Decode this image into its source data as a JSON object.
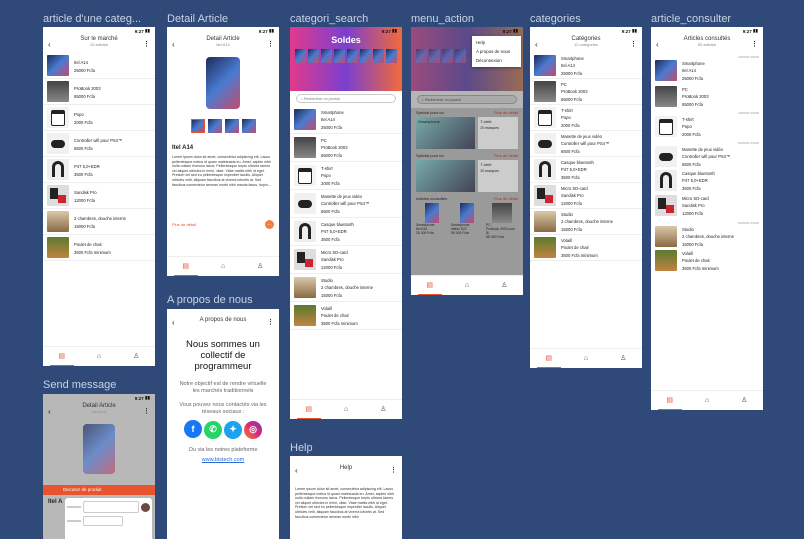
{
  "labels": {
    "article_categ": "article d'une categ...",
    "detail_article": "Detail Article",
    "categori_search": "categori_search",
    "menu_action": "menu_action",
    "categories": "categories",
    "article_consulter": "article_consulter",
    "a_propos": "A propos de nous",
    "send_message": "Send message",
    "help": "Help"
  },
  "status_time": "9:27",
  "screen1": {
    "title": "Sur le marché",
    "subtitle": "10 articles",
    "items": [
      {
        "name": "Itel A14",
        "price": "25000 Fcfa"
      },
      {
        "name": "ProBook 2003",
        "price": "65000 Fcfa"
      },
      {
        "name": "Popo",
        "price": "2000 Fcfa"
      },
      {
        "name": "Controller wifi pour PS4™",
        "price": "6500 Fcfa"
      },
      {
        "name": "P47 5,0+EDR",
        "price": "3500 Fcfa"
      },
      {
        "name": "Sandisk Pro",
        "price": "12000 Fcfa"
      },
      {
        "name": "2 chambres, douche interne",
        "price": "15000 Fcfa"
      },
      {
        "name": "Poulet de chair",
        "price": "3500 Fcfa minimum"
      }
    ]
  },
  "screen2": {
    "title": "Detail Article",
    "subtitle": "Itel A14",
    "product": "Itel A14",
    "description": "Lorem ipsum dolor sit amet, consectetur adipiscing elit. Lacus pellentesque metus id quam malesuada eu. Amet, sapien nibh nulla nullam rhoncus lacus. Pellentesque turpis ultrices fames vel aliquet ultricies in enim, vitae. Vitae mattis nibh id eget. Pretium vel sed eu pellentesque imperdiet iaculis. Aliquet ultricies velit, aliquam faucibus at viverra lobortis at. Sed faucibus consectetur aenean morbi nibh mauris facus, turpis...",
    "more": "Plus de détail"
  },
  "screen3": {
    "banner": "Soldes",
    "search_placeholder": "Rechercher un produit",
    "items": [
      {
        "name": "Smartphone",
        "name2": "Itel A14",
        "price": "25000 Fcfa"
      },
      {
        "name": "PC",
        "name2": "ProBook 2003",
        "price": "65000 Fcfa"
      },
      {
        "name": "T-shirt",
        "name2": "Popo",
        "price": "2000 Fcfa"
      },
      {
        "name": "Manette de jeux vidéo",
        "name2": "Controller wifi pour PS4™",
        "price": "6500 Fcfa"
      },
      {
        "name": "Casque bluetooth",
        "name2": "P47 5,0+EDR",
        "price": "3500 Fcfa"
      },
      {
        "name": "Micro SD-card",
        "name2": "Sandisk Pro",
        "price": "12000 Fcfa"
      },
      {
        "name": "Studio",
        "name2": "2 chambres, douche interne",
        "price": "15000 Fcfa"
      },
      {
        "name": "Volaill",
        "name2": "Poulet de chair",
        "price": "3500 Fcfa minimum"
      }
    ]
  },
  "screen4": {
    "menu": [
      "Help",
      "A propos de nous",
      "Déconnexion"
    ],
    "search_placeholder": "Rechercher un produit",
    "section1": "Spécial pour toi",
    "section2": "Spécial pour toi",
    "section3": "Articles consultés",
    "more": "Plus de détail",
    "card1": "Smartphone",
    "card2": "T-shirt",
    "card2_sub": "20 marques",
    "cards3": [
      {
        "name": "Smartphone",
        "sub": "Itel A14",
        "price": "25 000 Fcfa"
      },
      {
        "name": "Smartphone",
        "sub": "infinix S22",
        "price": "55 000 Fcfa"
      },
      {
        "name": "PC",
        "sub": "ProBook 2003 core i5",
        "price": "55 000 Fcfa"
      }
    ]
  },
  "screen5": {
    "title": "Catégories",
    "subtitle": "12 catégories",
    "items": [
      {
        "name": "Smartphone",
        "name2": "Itel A14",
        "price": "25000 Fcfa"
      },
      {
        "name": "PC",
        "name2": "ProBook 2003",
        "price": "65000 Fcfa"
      },
      {
        "name": "T-shirt",
        "name2": "Popo",
        "price": "2000 Fcfa"
      },
      {
        "name": "Manette de jeux vidéo",
        "name2": "Controller wifi pour PS4™",
        "price": "6500 Fcfa"
      },
      {
        "name": "Casque bluetooth",
        "name2": "P47 5,0+EDR",
        "price": "3500 Fcfa"
      },
      {
        "name": "Micro SD-card",
        "name2": "Sandisk Pro",
        "price": "12000 Fcfa"
      },
      {
        "name": "Studio",
        "name2": "2 chambres, douche interne",
        "price": "15000 Fcfa"
      },
      {
        "name": "Volaill",
        "name2": "Poulet de chair",
        "price": "3500 Fcfa minimum"
      }
    ]
  },
  "screen6": {
    "title": "Articles consultés",
    "subtitle": "50 articles",
    "items": [
      {
        "date": "23/06/22 18h45",
        "name": "Smartphone",
        "name2": "Itel A14",
        "price": "25000 Fcfa"
      },
      {
        "date": "",
        "name": "PC",
        "name2": "ProBook 2003",
        "price": "65000 Fcfa"
      },
      {
        "date": "20/06/22 16h30",
        "name": "T-shirt",
        "name2": "Popo",
        "price": "2000 Fcfa"
      },
      {
        "date": "03/05/22 15h45",
        "name": "Manette de jeux vidéo",
        "name2": "Controller wifi pour PS4™",
        "price": "6500 Fcfa"
      },
      {
        "date": "",
        "name": "Casque bluetooth",
        "name2": "P47 5,0+EDR",
        "price": "3500 Fcfa"
      },
      {
        "date": "",
        "name": "Micro SD-card",
        "name2": "Sandisk Pro",
        "price": "12000 Fcfa"
      },
      {
        "date": "03/05/22 15h45",
        "name": "Studio",
        "name2": "2 chambres, douche interne",
        "price": "15000 Fcfa"
      },
      {
        "date": "",
        "name": "Volaill",
        "name2": "Poulet de chair",
        "price": "3500 Fcfa minimum"
      }
    ]
  },
  "screen7": {
    "title": "A propos de nous",
    "heading": "Nous sommes un collectif de programmeur",
    "text1": "Notre objectif est de rendre virtuelle les marchés traditionnels",
    "text2": "Vous pouvez nous contactés via les réseaux sociaux :",
    "text3": "Ou via les notres plateforme",
    "link": "www.bistech.com"
  },
  "screen8": {
    "title": "Detail Article",
    "subtitle": "Itel A14",
    "bar": "Discutez de produit",
    "product": "Itel A"
  },
  "screen9": {
    "title": "Help",
    "text": "Lorem ipsum dolor sit amet, consectetur adipiscing elit. Lacus pellentesque metus id quam malesuada eu. Amet, sapien nibh nulla nullam rhoncus lacus. Pellentesque turpis ultrices fames vel aliquet ultricies in enim, vitae. Vitae mattis nibh id eget. Pretium vel sed eu pellentesque imperdiet iaculis. Aliquet ultricies velit, aliquam faucibus at viverra lobortis at. Sed faucibus consectetur aenean morbi nibh"
  },
  "colors": {
    "accent": "#e8542e",
    "canvas": "#2f4978"
  }
}
